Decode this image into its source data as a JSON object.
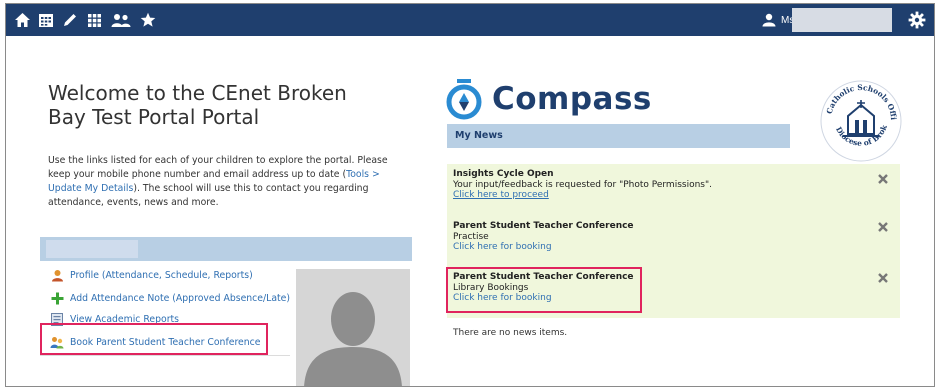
{
  "topbar": {
    "nav_icons": [
      "home-icon",
      "calendar-icon",
      "pencil-icon",
      "grid-icon",
      "people-icon",
      "star-icon"
    ],
    "user_name": "Ms",
    "settings_icon": "gear-icon"
  },
  "welcome": {
    "title": "Welcome to the CEnet Broken Bay Test Portal Portal",
    "text_before_link": "Use the links listed for each of your children to explore the portal. Please keep your mobile phone number and email address up to date (",
    "link_text": "Tools > Update My Details",
    "text_after_link": "). The school will use this to contact you regarding attendance, events, news and more."
  },
  "child_links": [
    {
      "label": "Profile (Attendance, Schedule, Reports)",
      "icon": "profile-icon"
    },
    {
      "label": "Add Attendance Note (Approved Absence/Late)",
      "icon": "plus-icon"
    },
    {
      "label": "View Academic Reports",
      "icon": "report-icon"
    },
    {
      "label": "Book Parent Student Teacher Conference",
      "icon": "conference-icon"
    }
  ],
  "compass": {
    "logo_text": "Compass",
    "news_header": "My News",
    "crest_text": "Catholic Schools Office · Diocese of Broken Bay"
  },
  "news": [
    {
      "title": "Insights Cycle Open",
      "body": "Your input/feedback is requested for \"Photo Permissions\".",
      "link": "Click here to proceed"
    },
    {
      "title": "Parent Student Teacher Conference",
      "body": "Practise",
      "link": "Click here for booking"
    },
    {
      "title": "Parent Student Teacher Conference",
      "body": "Library Bookings",
      "link": "Click here for booking"
    }
  ],
  "no_news_text": "There are no news items.",
  "colors": {
    "topbar": "#1f3f6e",
    "section_bar": "#b8cfe4",
    "news_bg": "#f0f7dc",
    "link": "#2f6fb2",
    "highlight": "#e0245e"
  }
}
